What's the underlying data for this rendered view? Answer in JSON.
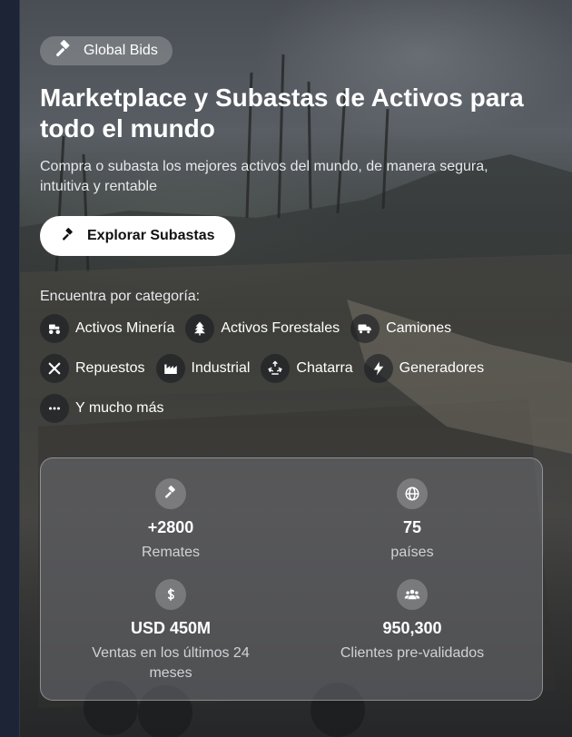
{
  "brand": {
    "name": "Global Bids",
    "icon": "gavel-icon"
  },
  "hero": {
    "title": "Marketplace y Subastas de Activos para todo el mundo",
    "subtitle": "Compra o subasta los mejores activos del mundo, de manera segura, intuitiva y rentable",
    "cta_label": "Explorar Subastas"
  },
  "categories": {
    "heading": "Encuentra por categoría:",
    "items": [
      {
        "label": "Activos Minería",
        "icon": "tractor-icon"
      },
      {
        "label": "Activos Forestales",
        "icon": "tree-icon"
      },
      {
        "label": "Camiones",
        "icon": "truck-icon"
      },
      {
        "label": "Repuestos",
        "icon": "tools-icon"
      },
      {
        "label": "Industrial",
        "icon": "industry-icon"
      },
      {
        "label": "Chatarra",
        "icon": "recycle-icon"
      },
      {
        "label": "Generadores",
        "icon": "bolt-icon"
      },
      {
        "label": "Y mucho más",
        "icon": "ellipsis-icon"
      }
    ]
  },
  "stats": [
    {
      "value": "+2800",
      "label": "Remates",
      "icon": "gavel-icon"
    },
    {
      "value": "75",
      "label": "países",
      "icon": "globe-icon"
    },
    {
      "value": "USD 450M",
      "label": "Ventas en los últimos 24 meses",
      "icon": "dollar-icon"
    },
    {
      "value": "950,300",
      "label": "Clientes pre-validados",
      "icon": "users-icon"
    }
  ],
  "colors": {
    "cta_bg": "#ffffff",
    "text": "#ffffff",
    "page_bg": "#1a2233"
  }
}
